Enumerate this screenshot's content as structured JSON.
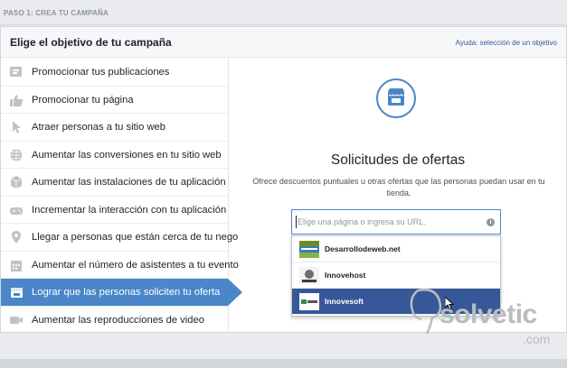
{
  "step": {
    "label": "PASO 1: CREA TU CAMPAÑA"
  },
  "panel": {
    "title": "Elige el objetivo de tu campaña",
    "help_link": "Ayuda: selección de un objetivo"
  },
  "objectives": [
    {
      "label": "Promocionar tus publicaciones",
      "icon": "megaphone-icon"
    },
    {
      "label": "Promocionar tu página",
      "icon": "thumbs-up-icon"
    },
    {
      "label": "Atraer personas a tu sitio web",
      "icon": "cursor-icon"
    },
    {
      "label": "Aumentar las conversiones en tu sitio web",
      "icon": "globe-icon"
    },
    {
      "label": "Aumentar las instalaciones de tu aplicación",
      "icon": "box-icon"
    },
    {
      "label": "Incrementar la interacción con tu aplicación",
      "icon": "gamepad-icon"
    },
    {
      "label": "Llegar a personas que están cerca de tu nego",
      "icon": "location-pin-icon"
    },
    {
      "label": "Aumentar el número de asistentes a tu evento",
      "icon": "calendar-icon"
    },
    {
      "label": "Lograr que las personas soliciten tu oferta",
      "icon": "store-icon",
      "selected": true
    },
    {
      "label": "Aumentar las reproducciones de video",
      "icon": "video-camera-icon"
    }
  ],
  "detail": {
    "title": "Solicitudes de ofertas",
    "description": "Ofrece descuentos puntuales u otras ofertas que las personas puedan usar en tu tienda.",
    "input_placeholder": "Elige una página o ingresa su URL."
  },
  "suggestions": [
    {
      "label": "Desarrollodeweb.net"
    },
    {
      "label": "Innovehost"
    },
    {
      "label": "Innovesoft",
      "active": true
    }
  ],
  "watermark": {
    "text": "solvetic",
    "suffix": ".com"
  },
  "colors": {
    "accent": "#4a86c8",
    "active": "#365899",
    "link": "#365899"
  }
}
